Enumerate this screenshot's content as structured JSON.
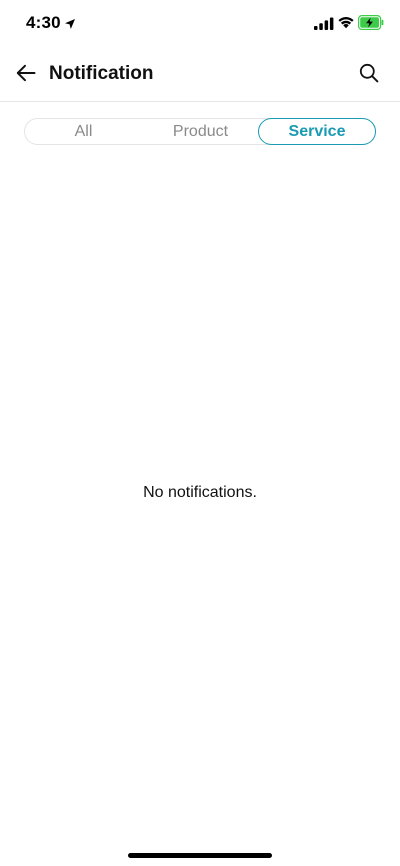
{
  "status_bar": {
    "time": "4:30",
    "icons": [
      "location-arrow-icon",
      "cellular-signal-icon",
      "wifi-icon",
      "battery-charging-icon"
    ],
    "battery_color": "#3ecb4a"
  },
  "header": {
    "title": "Notification",
    "back_icon": "arrow-left-icon",
    "search_icon": "search-icon"
  },
  "tabs": [
    {
      "label": "All",
      "selected": false
    },
    {
      "label": "Product",
      "selected": false
    },
    {
      "label": "Service",
      "selected": true
    }
  ],
  "accent_color": "#1a9bb3",
  "empty_state": {
    "message": "No notifications."
  }
}
